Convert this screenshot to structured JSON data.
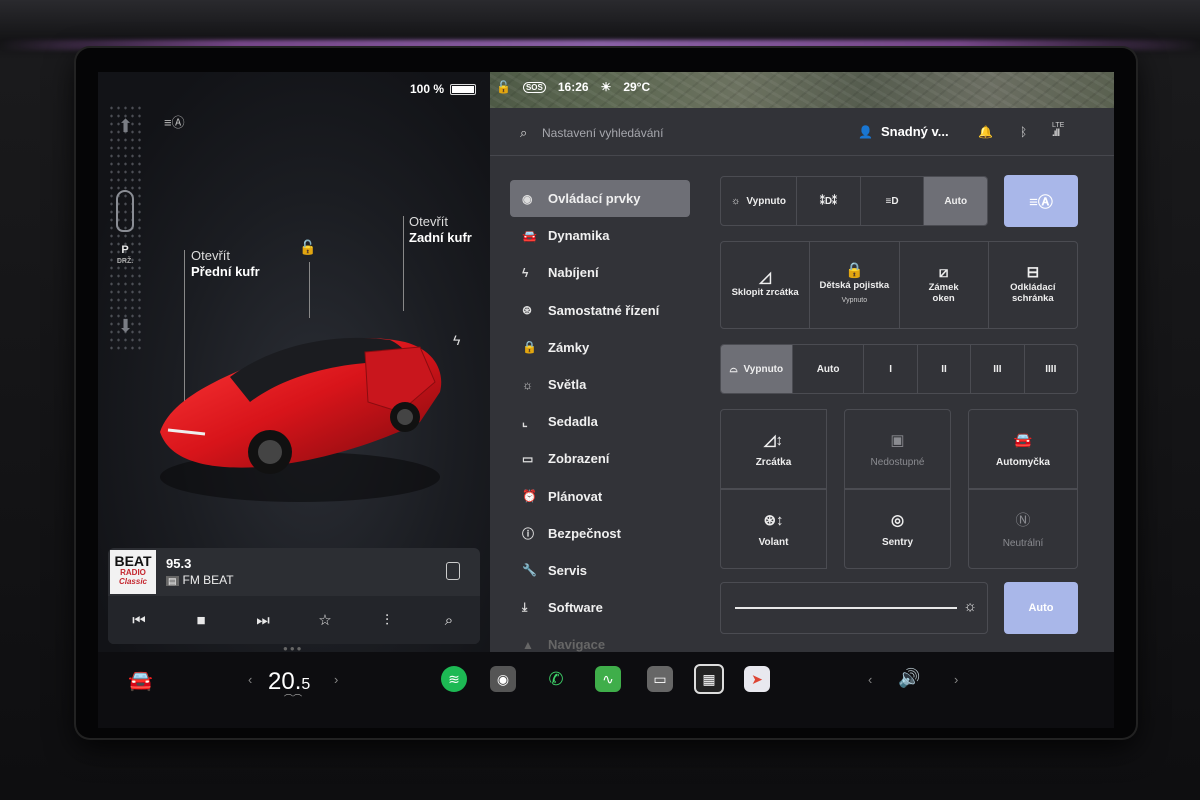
{
  "status": {
    "battery": "100 %",
    "time": "16:26",
    "temp": "29°C",
    "sos": "SOS",
    "lte": "LTE"
  },
  "car": {
    "gear": "P",
    "gear_sub": "DRŽ.",
    "frunk_action": "Otevřít",
    "frunk_label": "Přední kufr",
    "trunk_action": "Otevřít",
    "trunk_label": "Zadní kufr"
  },
  "media": {
    "logo_top": "BEAT",
    "logo_mid": "RADIO",
    "logo_bottom": "Classic",
    "frequency": "95.3",
    "band": "FM",
    "station": "FM BEAT"
  },
  "search": {
    "placeholder": "Nastavení vyhledávání"
  },
  "user": {
    "name": "Snadný v..."
  },
  "menu": [
    {
      "label": "Ovládací prvky",
      "icon": "toggle-icon"
    },
    {
      "label": "Dynamika",
      "icon": "car-icon"
    },
    {
      "label": "Nabíjení",
      "icon": "bolt-icon"
    },
    {
      "label": "Samostatné řízení",
      "icon": "steering-wheel-icon"
    },
    {
      "label": "Zámky",
      "icon": "lock-icon"
    },
    {
      "label": "Světla",
      "icon": "sun-icon"
    },
    {
      "label": "Sedadla",
      "icon": "seat-icon"
    },
    {
      "label": "Zobrazení",
      "icon": "display-icon"
    },
    {
      "label": "Plánovat",
      "icon": "clock-icon"
    },
    {
      "label": "Bezpečnost",
      "icon": "alert-icon"
    },
    {
      "label": "Servis",
      "icon": "wrench-icon"
    },
    {
      "label": "Software",
      "icon": "download-icon"
    },
    {
      "label": "Navigace",
      "icon": "navigation-icon"
    }
  ],
  "lights": {
    "off": "Vypnuto",
    "auto": "Auto",
    "selected": "Auto"
  },
  "quick": [
    {
      "label": "Sklopit zrcátka",
      "sub": "",
      "icon": "mirror-icon"
    },
    {
      "label": "Dětská pojistka",
      "sub": "Vypnuto",
      "icon": "child-lock-icon"
    },
    {
      "label": "Zámek oken",
      "sub": "",
      "icon": "window-lock-icon"
    },
    {
      "label": "Odkládací schránka",
      "sub": "",
      "icon": "glovebox-icon"
    }
  ],
  "wipers": {
    "off": "Vypnuto",
    "auto": "Auto",
    "levels": [
      "I",
      "II",
      "III",
      "IIII"
    ],
    "selected": "Vypnuto"
  },
  "tiles": [
    {
      "label": "Zrcátka",
      "icon": "mirror-adjust-icon",
      "enabled": true
    },
    {
      "label": "Nedostupné",
      "icon": "camera-icon",
      "enabled": false
    },
    {
      "label": "Automyčka",
      "icon": "car-wash-icon",
      "enabled": true
    },
    {
      "label": "Volant",
      "icon": "steering-adjust-icon",
      "enabled": true
    },
    {
      "label": "Sentry",
      "icon": "sentry-icon",
      "enabled": true
    },
    {
      "label": "Neutrální",
      "icon": "neutral-icon",
      "enabled": false
    }
  ],
  "brightness": {
    "auto_label": "Auto",
    "level": 1.0
  },
  "climate": {
    "temp_main": "20.",
    "temp_dec": "5"
  },
  "colors": {
    "accent_blue": "#a9b7e9",
    "panel": "#323338",
    "active": "#6e6f76"
  }
}
